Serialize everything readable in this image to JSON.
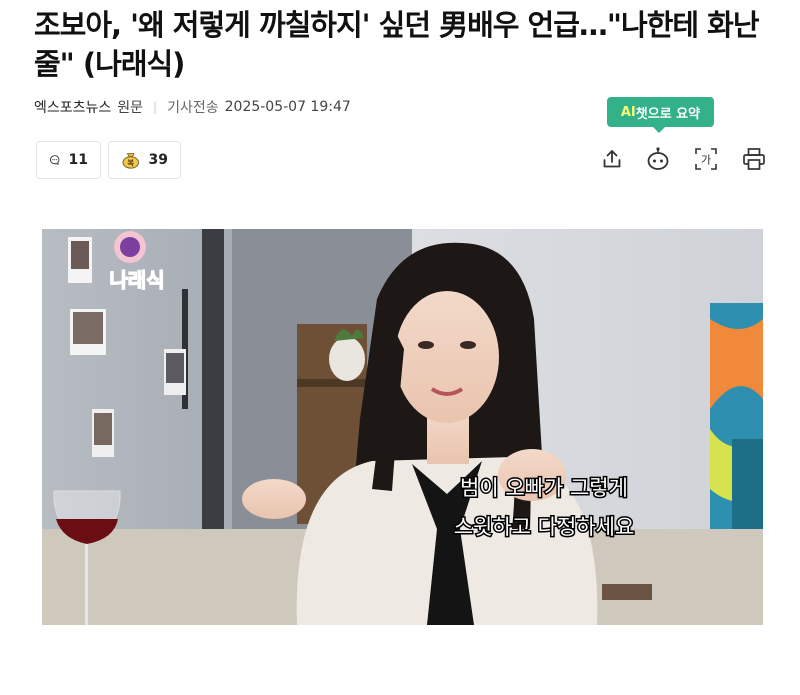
{
  "article": {
    "title": "조보아, '왜 저렇게 까칠하지' 싶던 男배우 언급…\"나한테 화난 줄\" (나래식)",
    "source": "엑스포츠뉴스",
    "original_label": "원문",
    "sent_label": "기사전송",
    "datetime": "2025-05-07 19:47"
  },
  "actions": {
    "comment_count": "11",
    "reaction_count": "39",
    "ai_tooltip_prefix": "AI",
    "ai_tooltip_rest": "챗으로 요약"
  },
  "photo": {
    "show_logo": "나래식",
    "subtitle_line1": "범이 오빠가 그렇게",
    "subtitle_line2": "스윗하고 다정하세요"
  },
  "colors": {
    "accent": "#33b28a",
    "title": "#111111",
    "meta": "#444444"
  }
}
